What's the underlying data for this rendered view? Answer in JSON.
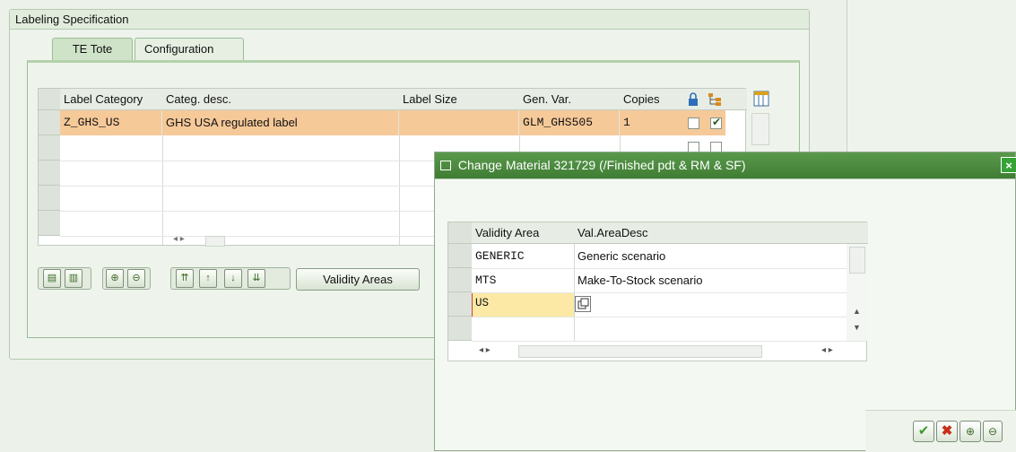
{
  "group": {
    "title": "Labeling Specification"
  },
  "tabs": [
    {
      "label": "TE Tote"
    },
    {
      "label": "Configuration"
    }
  ],
  "label_grid": {
    "columns": [
      "Label Category",
      "Categ. desc.",
      "Label Size",
      "Gen. Var.",
      "Copies"
    ],
    "rows": [
      {
        "category": "Z_GHS_US",
        "desc": "GHS USA regulated label",
        "size": "",
        "genvar": "GLM_GHS505",
        "copies": "1",
        "lock": false,
        "check": true
      }
    ]
  },
  "toolbar": {
    "validity_button": "Validity Areas"
  },
  "dialog": {
    "title": "Change Material 321729 (/Finished pdt & RM & SF)",
    "columns": [
      "Validity Area",
      "Val.AreaDesc"
    ],
    "rows": [
      {
        "area": "GENERIC",
        "desc": "Generic scenario"
      },
      {
        "area": "MTS",
        "desc": "Make-To-Stock scenario"
      },
      {
        "area": "US",
        "desc": ""
      }
    ]
  },
  "icons": {
    "lock": "lock-icon",
    "tree": "hierarchy-icon",
    "layout": "column-layout-icon",
    "confirm": "check-icon",
    "cancel": "cancel-icon",
    "insert": "insert-row-icon",
    "delete": "delete-row-icon"
  }
}
